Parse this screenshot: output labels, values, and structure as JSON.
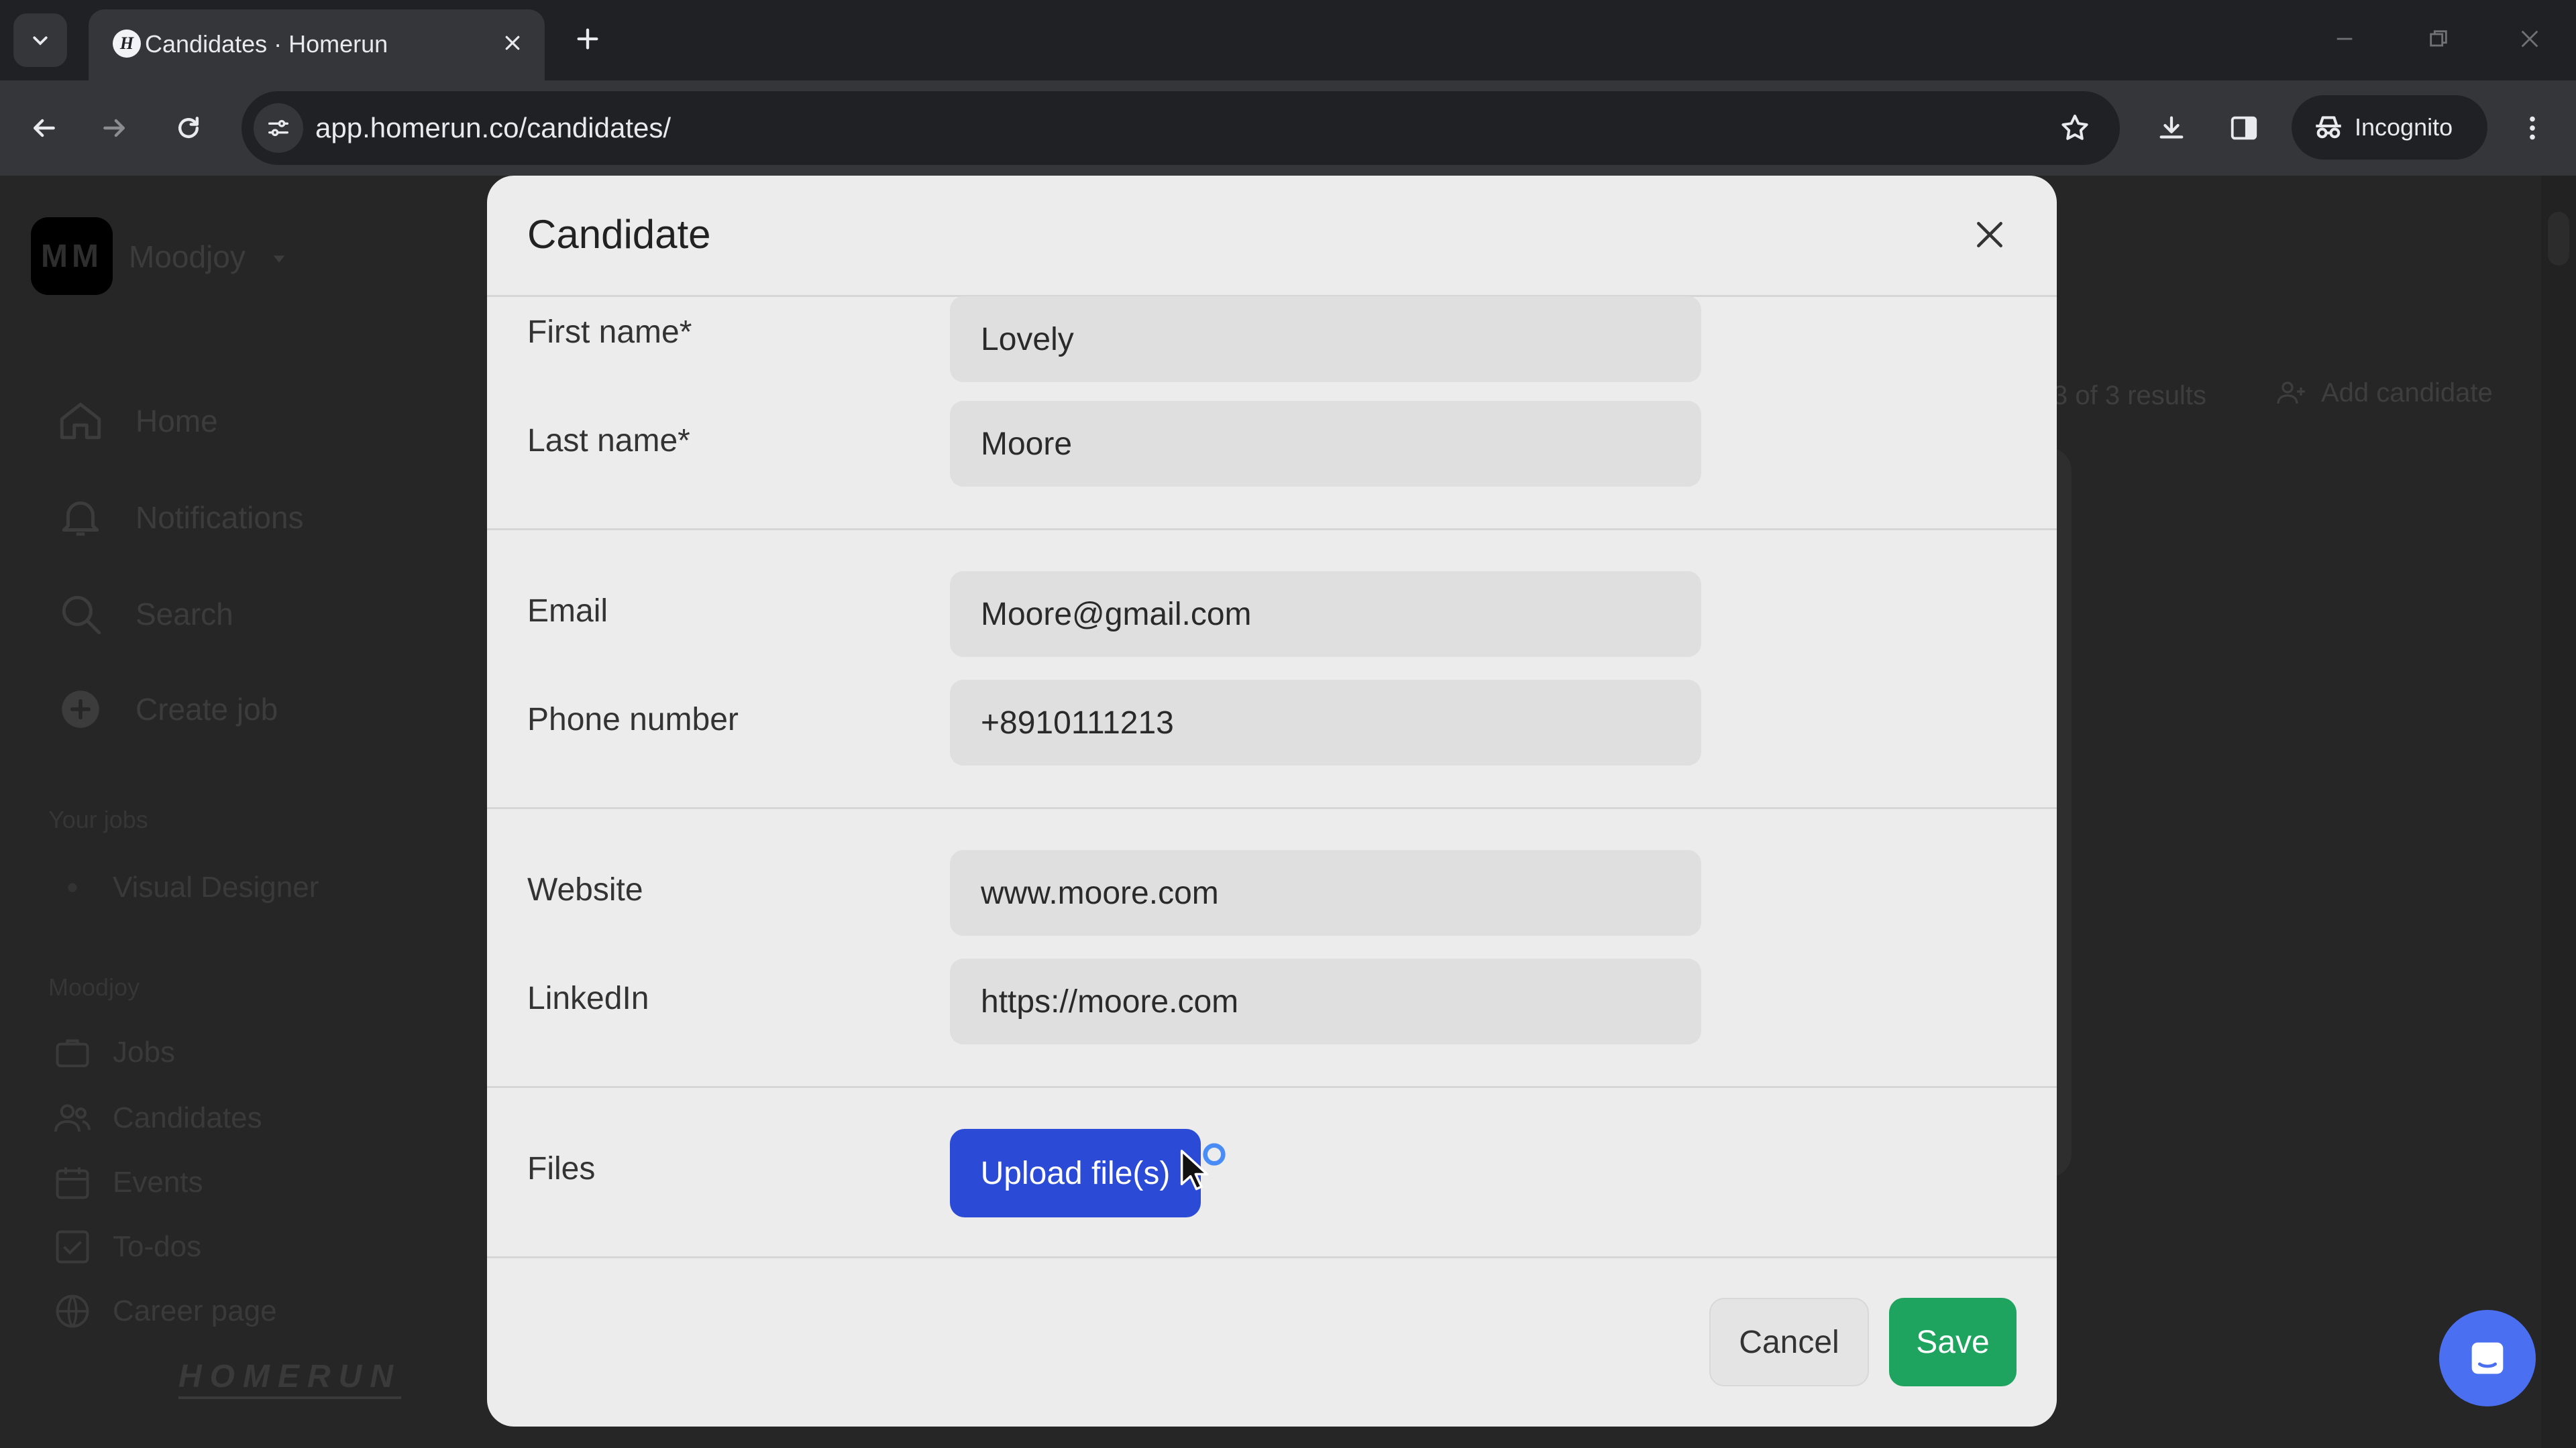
{
  "browser": {
    "tab_title": "Candidates · Homerun",
    "favicon_letter": "H",
    "url": "app.homerun.co/candidates/",
    "profile_label": "Incognito"
  },
  "app": {
    "workspace_initials": "MM",
    "workspace_name": "Moodjoy",
    "nav": [
      "Home",
      "Notifications",
      "Search",
      "Create job"
    ],
    "section_your_jobs": "Your jobs",
    "job_item": "Visual Designer",
    "section_company": "Moodjoy",
    "company_nav": [
      "Jobs",
      "Candidates",
      "Events",
      "To-dos",
      "Career page"
    ],
    "brand": "HOMERUN",
    "results_text": "3 of 3 results",
    "add_candidate_label": "Add candidate"
  },
  "modal": {
    "title": "Candidate",
    "fields": {
      "first_name": {
        "label": "First name*",
        "value": "Lovely"
      },
      "last_name": {
        "label": "Last name*",
        "value": "Moore"
      },
      "email": {
        "label": "Email",
        "value": "Moore@gmail.com"
      },
      "phone": {
        "label": "Phone number",
        "value": "+8910111213"
      },
      "website": {
        "label": "Website",
        "value": "www.moore.com"
      },
      "linkedin": {
        "label": "LinkedIn",
        "value": "https://moore.com"
      }
    },
    "files_label": "Files",
    "upload_label": "Upload file(s)",
    "cancel_label": "Cancel",
    "save_label": "Save"
  },
  "colors": {
    "primary_blue": "#2b4bd6",
    "save_green": "#1fa460",
    "chat_blue": "#4a6ff0"
  }
}
